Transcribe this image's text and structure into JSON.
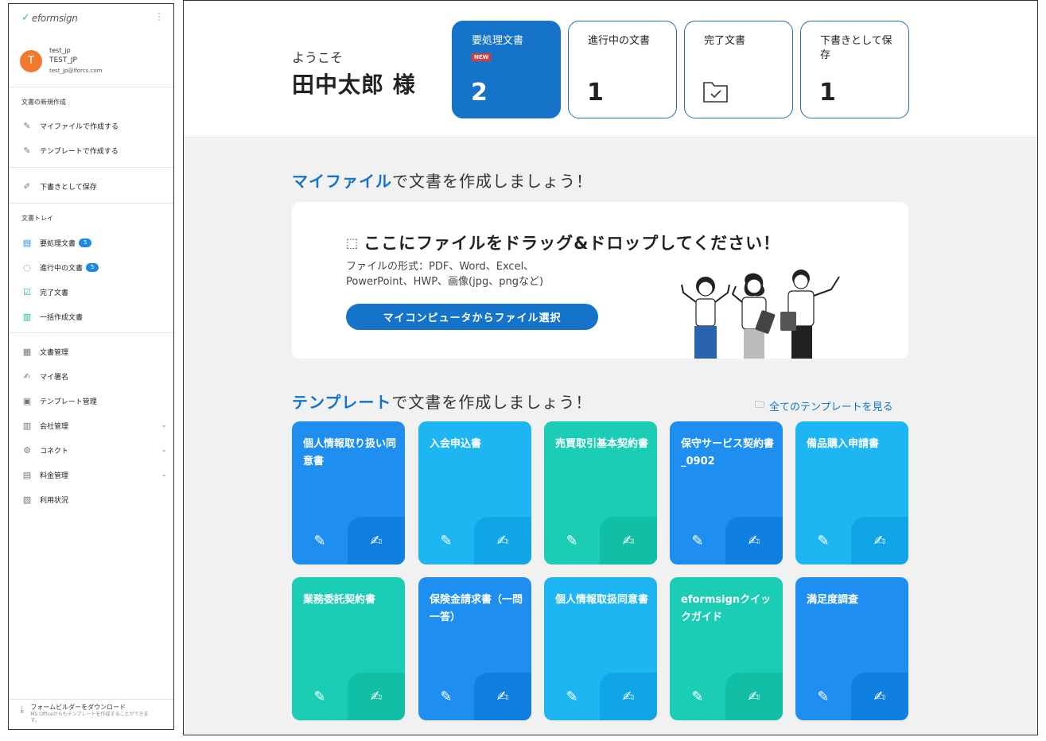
{
  "sidebar": {
    "logo": "eformsign",
    "profile": {
      "initial": "T",
      "id": "test_jp",
      "name": "TEST_JP",
      "email": "test_jp@iforcs.com"
    },
    "new_doc_section": "文書の新規作成",
    "new_doc_items": [
      {
        "label": "マイファイルで作成する",
        "icon": "file-edit-icon"
      },
      {
        "label": "テンプレートで作成する",
        "icon": "template-edit-icon"
      }
    ],
    "draft_label": "下書きとして保存",
    "tray_section": "文書トレイ",
    "tray_items": [
      {
        "label": "要処理文書",
        "badge": "5",
        "icon": "todo-doc-icon"
      },
      {
        "label": "進行中の文書",
        "badge": "5",
        "icon": "progress-doc-icon"
      },
      {
        "label": "完了文書",
        "badge": "",
        "icon": "completed-doc-icon"
      },
      {
        "label": "一括作成文書",
        "badge": "",
        "icon": "bulk-doc-icon"
      }
    ],
    "manage_items": [
      {
        "label": "文書管理",
        "chevron": false,
        "icon": "doc-manage-icon"
      },
      {
        "label": "マイ署名",
        "chevron": false,
        "icon": "signature-icon"
      },
      {
        "label": "テンプレート管理",
        "chevron": false,
        "icon": "template-manage-icon"
      },
      {
        "label": "会社管理",
        "chevron": true,
        "icon": "company-icon"
      },
      {
        "label": "コネクト",
        "chevron": true,
        "icon": "connect-icon"
      },
      {
        "label": "料金管理",
        "chevron": true,
        "icon": "billing-icon"
      },
      {
        "label": "利用状況",
        "chevron": false,
        "icon": "usage-icon"
      }
    ],
    "footer_title": "フォームビルダーをダウンロード",
    "footer_desc": "MS Officeからもテンプレートを作成することができます。"
  },
  "header": {
    "welcome": "ようこそ",
    "username": "田中太郎 様",
    "stats": [
      {
        "label": "要処理文書",
        "count": "2",
        "new_badge": "NEW",
        "active": true
      },
      {
        "label": "進行中の文書",
        "count": "1",
        "new_badge": "",
        "active": false
      },
      {
        "label": "完了文書",
        "count": "",
        "new_badge": "",
        "active": false,
        "icon": "folder-check-icon"
      },
      {
        "label": "下書きとして保存",
        "count": "1",
        "new_badge": "",
        "active": false
      }
    ]
  },
  "myfile_section": {
    "highlight": "マイファイル",
    "rest": "で文書を作成しましょう！"
  },
  "dropzone": {
    "title": "ここにファイルをドラッグ&ドロップしてください！",
    "desc_line1": "ファイルの形式：PDF、Word、Excel、",
    "desc_line2": "PowerPoint、HWP、画像(jpg、pngなど)",
    "button": "マイコンピュータからファイル選択"
  },
  "template_section": {
    "highlight": "テンプレート",
    "rest": "で文書を作成しましょう！",
    "view_all": "全てのテンプレートを見る"
  },
  "templates": [
    {
      "title": "個人情報取り扱い同意書",
      "color": "blue"
    },
    {
      "title": "入会申込書",
      "color": "sky"
    },
    {
      "title": "売買取引基本契約書",
      "color": "teal"
    },
    {
      "title": "保守サービス契約書_0902",
      "color": "blue"
    },
    {
      "title": "備品購入申請書",
      "color": "sky"
    },
    {
      "title": "業務委託契約書",
      "color": "teal"
    },
    {
      "title": "保険金請求書（一問一答）",
      "color": "blue"
    },
    {
      "title": "個人情報取扱同意書",
      "color": "sky"
    },
    {
      "title": "eformsignクイックガイド",
      "color": "teal"
    },
    {
      "title": "満足度調査",
      "color": "blue"
    }
  ],
  "colors": {
    "primary": "#1574c9",
    "blue": "#1e8ff0",
    "sky": "#1db6f2",
    "teal": "#1ccdb5",
    "new_badge": "#e53935",
    "avatar": "#f07b2d"
  }
}
